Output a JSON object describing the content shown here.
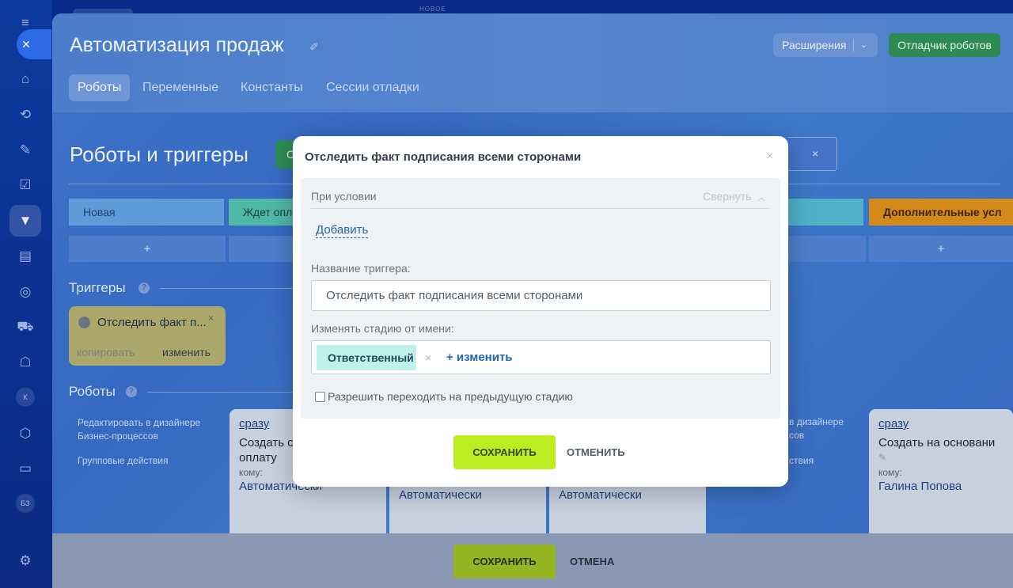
{
  "rail": {
    "circle_k": "К",
    "circle_bz": "БЗ"
  },
  "top": {
    "faint_label": "НОВОЕ"
  },
  "header": {
    "title": "Автоматизация продаж",
    "extensions_label": "Расширения",
    "debugger_label": "Отладчик роботов",
    "tabs": [
      {
        "label": "Роботы"
      },
      {
        "label": "Переменные"
      },
      {
        "label": "Константы"
      },
      {
        "label": "Сессии отладки"
      }
    ]
  },
  "main": {
    "section_title": "Роботы и триггеры",
    "green_stub": "С",
    "stages": [
      {
        "label": "Новая"
      },
      {
        "label": "Ждет опл"
      },
      {
        "label": ""
      },
      {
        "label": "Дополнительные усл"
      }
    ],
    "plus": "+",
    "triggers_title": "Триггеры",
    "trigger_card": {
      "name": "Отследить факт п...",
      "copy": "копировать",
      "edit": "изменить"
    },
    "robots_title": "Роботы",
    "robots_side_edit": "Редактировать в дизайнере Бизнес-процессов",
    "robots_side_group": "Групповые действия",
    "right_side_edit_1": "в дизайнере",
    "right_side_edit_2": "сов",
    "right_side_group": "ствия",
    "robot_cards": [
      {
        "when": "сразу",
        "name_l1": "Создать с",
        "name_l2": "оплату",
        "to": "кому:",
        "who": "Автоматически"
      },
      {
        "when": "",
        "name_l1": "",
        "name_l2": "",
        "to": "",
        "who": "Автоматически"
      },
      {
        "when": "",
        "name_l1": "",
        "name_l2": "",
        "to": "",
        "who": "Автоматически"
      },
      {
        "when": "сразу",
        "name_l1": "Создать на основани",
        "name_l2": "",
        "to": "кому:",
        "who": "Галина Попова"
      }
    ]
  },
  "footer": {
    "save_label": "СОХРАНИТЬ",
    "cancel_label": "ОТМЕНА"
  },
  "modal": {
    "title": "Отследить факт подписания всеми сторонами",
    "condition_label": "При условии",
    "collapse_label": "Свернуть",
    "add_label": "Добавить",
    "trigger_name_label": "Название триггера:",
    "trigger_name_value": "Отследить факт подписания всеми сторонами",
    "change_stage_label": "Изменять стадию от имени:",
    "responsible_tag": "Ответственный",
    "change_link": "+ изменить",
    "allow_prev_label": "Разрешить переходить на предыдущую стадию",
    "save_label": "СОХРАНИТЬ",
    "cancel_label": "ОТМЕНИТЬ"
  },
  "colors": {
    "modal_save": "#bbed21",
    "link_blue": "#2066b0",
    "tag_bg": "#bff0ec",
    "stage_extra": "#d48a1a"
  }
}
